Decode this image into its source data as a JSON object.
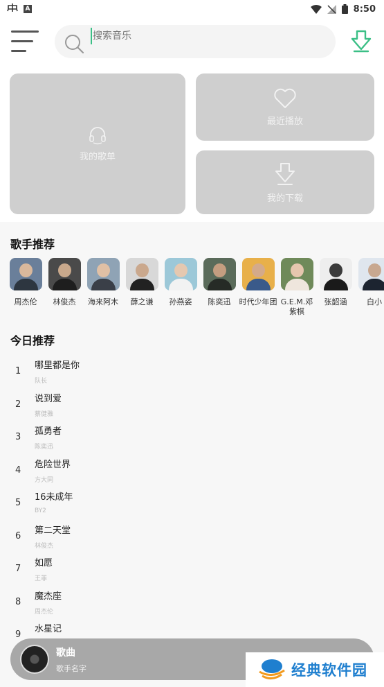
{
  "status_bar": {
    "time": "8:50"
  },
  "search": {
    "placeholder": "搜索音乐"
  },
  "cards": {
    "my_playlist": "我的歌单",
    "recent_play": "最近播放",
    "my_download": "我的下载"
  },
  "artists_section": {
    "title": "歌手推荐",
    "items": [
      {
        "name": "周杰伦",
        "icon": "avatar-photo"
      },
      {
        "name": "林俊杰",
        "icon": "avatar-photo"
      },
      {
        "name": "海来阿木",
        "icon": "avatar-photo"
      },
      {
        "name": "薛之谦",
        "icon": "avatar-photo"
      },
      {
        "name": "孙燕姿",
        "icon": "avatar-photo"
      },
      {
        "name": "陈奕迅",
        "icon": "avatar-photo"
      },
      {
        "name": "时代少年团",
        "icon": "avatar-photo"
      },
      {
        "name": "G.E.M.邓紫棋",
        "icon": "avatar-photo"
      },
      {
        "name": "张韶涵",
        "icon": "avatar-photo"
      },
      {
        "name": "白小",
        "icon": "avatar-photo"
      }
    ]
  },
  "today_section": {
    "title": "今日推荐",
    "songs": [
      {
        "rank": "1",
        "title": "哪里都是你",
        "artist": "队长"
      },
      {
        "rank": "2",
        "title": "说到爱",
        "artist": "蔡健雅"
      },
      {
        "rank": "3",
        "title": "孤勇者",
        "artist": "陈奕迅"
      },
      {
        "rank": "4",
        "title": "危险世界",
        "artist": "方大同"
      },
      {
        "rank": "5",
        "title": "16未成年",
        "artist": "BY2"
      },
      {
        "rank": "6",
        "title": "第二天堂",
        "artist": "林俊杰"
      },
      {
        "rank": "7",
        "title": "如愿",
        "artist": "王菲"
      },
      {
        "rank": "8",
        "title": "魔杰座",
        "artist": "周杰伦"
      },
      {
        "rank": "9",
        "title": "水星记",
        "artist": ""
      }
    ]
  },
  "player": {
    "song": "歌曲",
    "artist": "歌手名字"
  },
  "watermark": {
    "text": "经典软件园"
  },
  "colors": {
    "accent": "#3bbf86",
    "card": "#cfcfcf",
    "player": "#a8a8a8"
  }
}
